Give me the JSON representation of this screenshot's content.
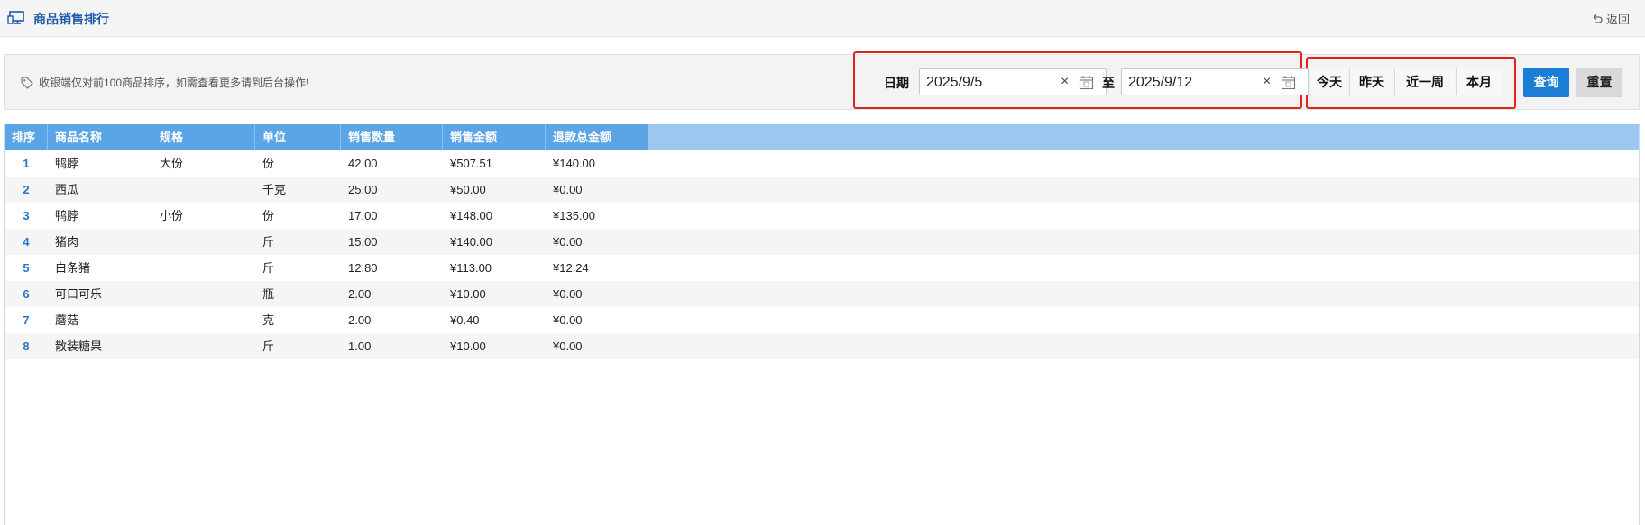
{
  "header": {
    "title": "商品销售排行",
    "back_label": "返回"
  },
  "filter": {
    "tip": "收银端仅对前100商品排序，如需查看更多请到后台操作!",
    "date_label": "日期",
    "start_date": "2025/9/5",
    "to_label": "至",
    "end_date": "2025/9/12",
    "clear_glyph": "×",
    "quick_ranges": [
      "今天",
      "昨天",
      "近一周",
      "本月"
    ],
    "query_label": "查询",
    "reset_label": "重置"
  },
  "colors": {
    "header_blue": "#5ba4e6",
    "accent_blue": "#1a7ed6",
    "highlight_red": "#e0231c"
  },
  "table": {
    "columns": [
      "排序",
      "商品名称",
      "规格",
      "单位",
      "销售数量",
      "销售金额",
      "退款总金额"
    ],
    "rows": [
      [
        "1",
        "鸭脖",
        "大份",
        "份",
        "42.00",
        "¥507.51",
        "¥140.00"
      ],
      [
        "2",
        "西瓜",
        "",
        "千克",
        "25.00",
        "¥50.00",
        "¥0.00"
      ],
      [
        "3",
        "鸭脖",
        "小份",
        "份",
        "17.00",
        "¥148.00",
        "¥135.00"
      ],
      [
        "4",
        "猪肉",
        "",
        "斤",
        "15.00",
        "¥140.00",
        "¥0.00"
      ],
      [
        "5",
        "白条猪",
        "",
        "斤",
        "12.80",
        "¥113.00",
        "¥12.24"
      ],
      [
        "6",
        "可口可乐",
        "",
        "瓶",
        "2.00",
        "¥10.00",
        "¥0.00"
      ],
      [
        "7",
        "蘑菇",
        "",
        "克",
        "2.00",
        "¥0.40",
        "¥0.00"
      ],
      [
        "8",
        "散装糖果",
        "",
        "斤",
        "1.00",
        "¥10.00",
        "¥0.00"
      ]
    ]
  }
}
